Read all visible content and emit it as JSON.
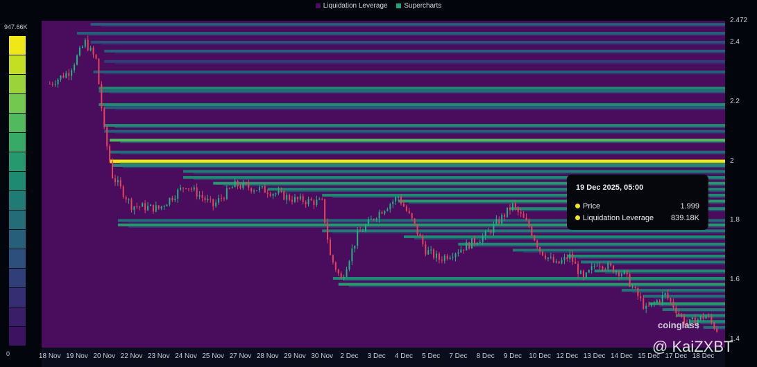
{
  "legend": [
    {
      "label": "Liquidation Leverage",
      "color": "#4a0d5e"
    },
    {
      "label": "Supercharts",
      "color": "#1fa57a"
    }
  ],
  "colorbar": {
    "max_label": "947.66K",
    "min_label": "0",
    "colors": [
      "#f0e716",
      "#c4df22",
      "#9bd43a",
      "#73c84f",
      "#52ba5e",
      "#38aa68",
      "#26996f",
      "#1f8a72",
      "#217b75",
      "#246c78",
      "#275e7a",
      "#2c4f7b",
      "#313f79",
      "#362e72",
      "#3a1e68",
      "#3c1261"
    ]
  },
  "chart_data": {
    "type": "heatmap",
    "title": "",
    "ylim": [
      1.372,
      2.472
    ],
    "y_ticks": [
      "2.472",
      "2.4",
      "2.2",
      "2",
      "1.8",
      "1.6",
      "1.4"
    ],
    "y_tick_values": [
      2.472,
      2.4,
      2.2,
      2.0,
      1.8,
      1.6,
      1.4
    ],
    "x_ticks": [
      "18 Nov",
      "19 Nov",
      "20 Nov",
      "22 Nov",
      "23 Nov",
      "24 Nov",
      "25 Nov",
      "27 Nov",
      "28 Nov",
      "29 Nov",
      "30 Nov",
      "2 Dec",
      "3 Dec",
      "4 Dec",
      "5 Dec",
      "7 Dec",
      "8 Dec",
      "9 Dec",
      "10 Dec",
      "12 Dec",
      "13 Dec",
      "14 Dec",
      "15 Dec",
      "17 Dec",
      "18 Dec"
    ],
    "x_range_index": [
      -0.3,
      24.8
    ],
    "price_path": [
      [
        0,
        2.26
      ],
      [
        0.7,
        2.3
      ],
      [
        1.3,
        2.4
      ],
      [
        1.7,
        2.34
      ],
      [
        2,
        2.1
      ],
      [
        2.3,
        1.95
      ],
      [
        3,
        1.85
      ],
      [
        4,
        1.84
      ],
      [
        5,
        1.92
      ],
      [
        6,
        1.85
      ],
      [
        6.8,
        1.92
      ],
      [
        8,
        1.9
      ],
      [
        9,
        1.87
      ],
      [
        10,
        1.86
      ],
      [
        10.3,
        1.68
      ],
      [
        10.7,
        1.6
      ],
      [
        11.3,
        1.75
      ],
      [
        12,
        1.82
      ],
      [
        12.8,
        1.88
      ],
      [
        13.3,
        1.8
      ],
      [
        13.8,
        1.7
      ],
      [
        14.3,
        1.67
      ],
      [
        15,
        1.7
      ],
      [
        16,
        1.75
      ],
      [
        17,
        1.85
      ],
      [
        17.6,
        1.78
      ],
      [
        18,
        1.7
      ],
      [
        18.6,
        1.65
      ],
      [
        19.1,
        1.68
      ],
      [
        19.6,
        1.6
      ],
      [
        20.1,
        1.66
      ],
      [
        21.1,
        1.62
      ],
      [
        21.9,
        1.5
      ],
      [
        22.6,
        1.55
      ],
      [
        23.4,
        1.45
      ],
      [
        24.1,
        1.48
      ],
      [
        24.6,
        1.42
      ]
    ],
    "bands": [
      [
        2.46,
        0.35,
        1.5
      ],
      [
        2.43,
        0.3,
        1
      ],
      [
        2.4,
        0.25,
        1.5
      ],
      [
        2.37,
        0.3,
        2
      ],
      [
        2.335,
        0.2,
        2
      ],
      [
        2.3,
        0.35,
        1.6
      ],
      [
        2.245,
        0.55,
        1.8
      ],
      [
        2.235,
        0.4,
        1.8
      ],
      [
        2.19,
        0.5,
        1.8
      ],
      [
        2.18,
        0.3,
        2
      ],
      [
        2.12,
        0.55,
        2
      ],
      [
        2.1,
        0.3,
        2
      ],
      [
        2.07,
        0.7,
        2.2
      ],
      [
        2.03,
        0.4,
        2.2
      ],
      [
        2.0,
        1.0,
        2.2
      ],
      [
        1.985,
        0.5,
        2.3
      ],
      [
        1.965,
        0.45,
        4.9
      ],
      [
        1.945,
        0.5,
        4.9
      ],
      [
        1.925,
        0.6,
        6
      ],
      [
        1.905,
        0.55,
        8
      ],
      [
        1.885,
        0.5,
        10
      ],
      [
        1.865,
        0.6,
        12.8
      ],
      [
        1.84,
        0.55,
        16.9
      ],
      [
        1.8,
        0.4,
        2.5
      ],
      [
        1.785,
        0.6,
        2.5
      ],
      [
        1.765,
        0.45,
        10
      ],
      [
        1.745,
        0.55,
        13
      ],
      [
        1.72,
        0.5,
        15
      ],
      [
        1.7,
        0.45,
        17
      ],
      [
        1.68,
        0.5,
        19
      ],
      [
        1.66,
        0.45,
        19.5
      ],
      [
        1.63,
        0.55,
        20
      ],
      [
        1.605,
        0.5,
        10.4
      ],
      [
        1.585,
        0.6,
        10.6
      ],
      [
        1.565,
        0.45,
        21
      ],
      [
        1.545,
        0.4,
        21.8
      ],
      [
        1.52,
        0.6,
        22
      ],
      [
        1.5,
        0.45,
        22.5
      ],
      [
        1.48,
        0.5,
        23
      ],
      [
        1.46,
        0.55,
        23.5
      ],
      [
        1.44,
        0.4,
        24
      ]
    ]
  },
  "tooltip": {
    "title": "19 Dec 2025, 05:00",
    "rows": [
      {
        "label": "Price",
        "value": "1.999"
      },
      {
        "label": "Liquidation Leverage",
        "value": "839.18K"
      }
    ]
  },
  "watermarks": {
    "coinglass": "coinglass",
    "author": "@ KaiZXBT"
  }
}
